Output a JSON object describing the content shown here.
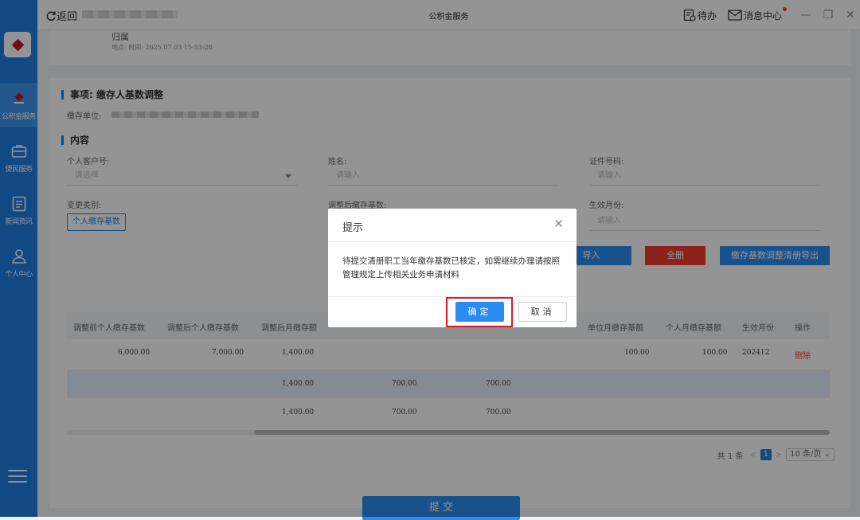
{
  "sidebar": {
    "items": [
      {
        "label": "公积金服务",
        "icon": "housing-fund-icon",
        "active": true
      },
      {
        "label": "便民服务",
        "icon": "briefcase-icon"
      },
      {
        "label": "新闻资讯",
        "icon": "news-icon"
      },
      {
        "label": "个人中心",
        "icon": "user-icon"
      }
    ],
    "menu_icon": "menu-icon"
  },
  "titlebar": {
    "back_label": "返回",
    "title": "公积金服务",
    "todo_label": "待办",
    "messages_label": "消息中心"
  },
  "top_card": {
    "line1": "归属",
    "line2": "地点:      时间: 2025.07.03 15:53:28"
  },
  "form": {
    "item_title": "事项: 缴存人基数调整",
    "unit_label": "缴存单位:",
    "content_title": "内容",
    "customer_no_label": "个人客户号:",
    "customer_no_placeholder": "请选择",
    "name_label": "姓名:",
    "name_placeholder": "请输入",
    "id_label": "证件号码:",
    "id_placeholder": "请输入",
    "change_type_label": "变更类别:",
    "change_type_value": "个人缴存基数",
    "adjusted_base_label": "调整后缴存基数:",
    "effective_month_label": "生效月份:",
    "effective_month_placeholder": "请输入"
  },
  "actions": {
    "import_label": "导入",
    "delete_all_label": "全删",
    "export_label": "缴存基数调整清册导出"
  },
  "table": {
    "headers": [
      "调整前个人缴存基数",
      "调整后个人缴存基数",
      "调整后月缴存额",
      "单位月缴存基额",
      "个人月缴存基额",
      "生效月份",
      "操作"
    ],
    "rows": [
      {
        "before": "6,000.00",
        "after": "7,000.00",
        "monthly": "1,400.00",
        "unit": "100.00",
        "personal": "100.00",
        "month": "202412",
        "op": "删除"
      },
      {
        "monthly": "1,400.00",
        "c4": "700.00",
        "c5": "700.00"
      },
      {
        "monthly": "1,400.00",
        "c4": "700.00",
        "c5": "700.00"
      }
    ]
  },
  "pagination": {
    "total": "共 1 条",
    "current": "1",
    "page_size": "10 条/页"
  },
  "submit_label": "提 交",
  "dialog": {
    "title": "提示",
    "message": "待提交清册职工当年缴存基数已核定，如需继续办理请按照管理规定上传相关业务申请材料",
    "confirm_label": "确定",
    "cancel_label": "取消"
  },
  "colors": {
    "primary": "#1e7fe6",
    "danger": "#f23b2f",
    "highlight": "#e0182b"
  }
}
